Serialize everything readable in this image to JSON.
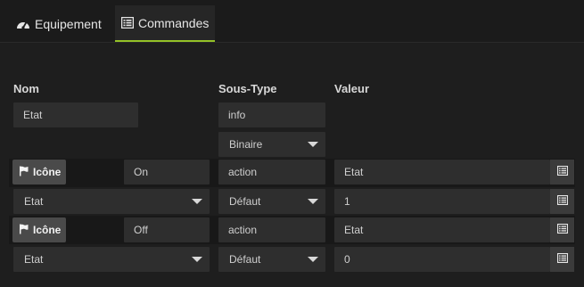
{
  "tabs": [
    {
      "label": "Equipement",
      "icon": "dashboard-icon",
      "active": false
    },
    {
      "label": "Commandes",
      "icon": "list-icon",
      "active": true
    }
  ],
  "table": {
    "headers": {
      "nom": "Nom",
      "sous_type": "Sous-Type",
      "valeur": "Valeur"
    },
    "info_cmd": {
      "name": "Etat",
      "type": "info",
      "subtype": "Binaire"
    },
    "actions": [
      {
        "icon_label": "Icône",
        "name": "On",
        "type": "action",
        "value_name": "Etat",
        "link": "Etat",
        "subtype": "Défaut",
        "value": "1"
      },
      {
        "icon_label": "Icône",
        "name": "Off",
        "type": "action",
        "value_name": "Etat",
        "link": "Etat",
        "subtype": "Défaut",
        "value": "0"
      }
    ]
  },
  "colors": {
    "accent": "#94c227",
    "background": "#1e1e1e",
    "field": "#2e2e2e"
  }
}
